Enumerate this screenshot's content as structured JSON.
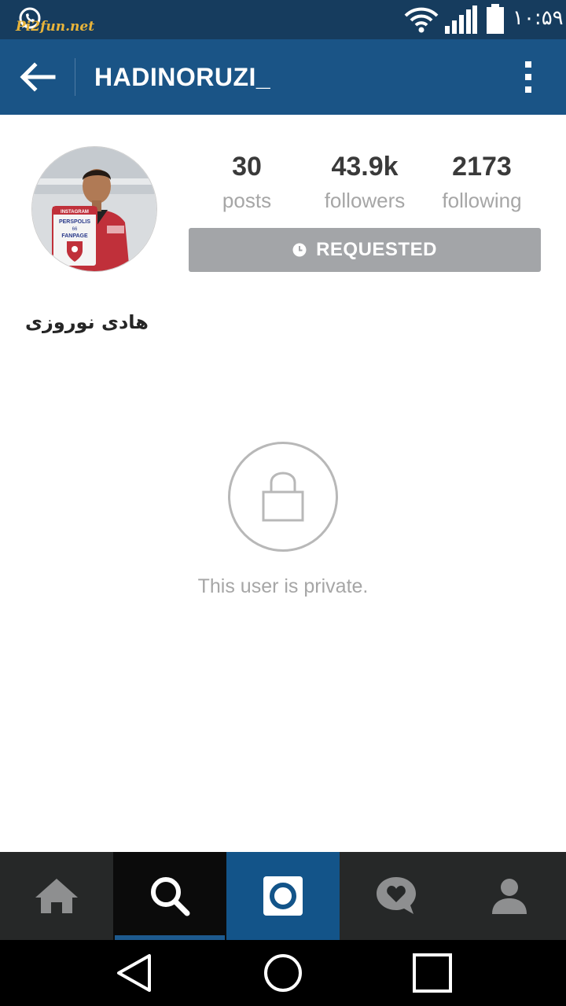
{
  "status_bar": {
    "watermark": "Pi2fun.net",
    "time": "۱۰:۵۹",
    "icons": [
      "whatsapp-icon",
      "wifi-icon",
      "cell-signal-icon",
      "battery-icon"
    ]
  },
  "app_bar": {
    "title": "HADINORUZI_",
    "back_icon": "arrow-left-icon",
    "menu_icon": "more-vertical-icon"
  },
  "profile": {
    "avatar_badge": {
      "line1": "INSTAGRAM",
      "line2": "PERSPOLIS",
      "line3": "66",
      "line4": "FANPAGE"
    },
    "stats": [
      {
        "value": "30",
        "label": "posts"
      },
      {
        "value": "43.9k",
        "label": "followers"
      },
      {
        "value": "2173",
        "label": "following"
      }
    ],
    "follow_button": {
      "label": "REQUESTED",
      "icon": "clock-icon"
    },
    "full_name": "هادی نوروزی"
  },
  "private_notice": {
    "icon": "lock-icon",
    "text": "This user is private."
  },
  "tab_bar": {
    "tabs": [
      {
        "icon": "home-icon",
        "active": false
      },
      {
        "icon": "search-icon",
        "active": true
      },
      {
        "icon": "camera-icon",
        "active": false
      },
      {
        "icon": "activity-heart-icon",
        "active": false
      },
      {
        "icon": "profile-icon",
        "active": false
      }
    ]
  },
  "nav_bar": {
    "buttons": [
      "back-triangle-icon",
      "home-circle-icon",
      "recents-square-icon"
    ]
  },
  "colors": {
    "status_bar": "#163c5e",
    "app_bar": "#1a5486",
    "requested_button": "#a3a5a8",
    "tab_bar": "#262828",
    "tab_camera": "#135489",
    "tab_underline": "#1d5a8e"
  }
}
